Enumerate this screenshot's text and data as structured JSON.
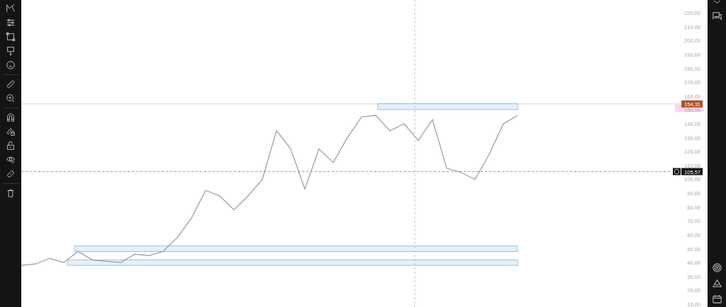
{
  "chart_data": {
    "type": "line",
    "ylim": [
      8,
      229.2
    ],
    "yticks": [
      {
        "value": 220,
        "label": "220,00"
      },
      {
        "value": 210,
        "label": "210,00"
      },
      {
        "value": 200,
        "label": "200,00"
      },
      {
        "value": 190,
        "label": "190,00"
      },
      {
        "value": 180,
        "label": "180,00"
      },
      {
        "value": 170,
        "label": "170,00"
      },
      {
        "value": 160,
        "label": "160,00"
      },
      {
        "value": 150,
        "label": "150,00"
      },
      {
        "value": 140,
        "label": "140,00"
      },
      {
        "value": 130,
        "label": "130,00"
      },
      {
        "value": 120,
        "label": "120,00"
      },
      {
        "value": 110,
        "label": "110,00"
      },
      {
        "value": 100,
        "label": "100,00"
      },
      {
        "value": 90,
        "label": "90,00"
      },
      {
        "value": 80,
        "label": "80,00"
      },
      {
        "value": 70,
        "label": "70,00"
      },
      {
        "value": 60,
        "label": "60,00"
      },
      {
        "value": 50,
        "label": "50,00"
      },
      {
        "value": 40,
        "label": "40,00"
      },
      {
        "value": 30,
        "label": "30,00"
      },
      {
        "value": 20,
        "label": "20,00"
      },
      {
        "value": 10,
        "label": "10,00"
      }
    ],
    "series": [
      {
        "color": "#9a9a9a",
        "values": [
          38,
          39,
          43,
          40,
          48,
          42,
          41,
          40,
          46,
          45,
          48,
          58,
          72,
          92,
          88,
          78,
          88,
          100,
          135,
          122,
          93,
          122,
          112,
          130,
          145,
          146,
          135,
          140,
          128,
          143,
          108,
          105,
          100,
          118,
          140,
          146
        ]
      }
    ],
    "ref_lines": [
      {
        "axis": "y",
        "value": 154.31,
        "label": "154,31",
        "color": "#d8d8d8"
      },
      {
        "axis": "y",
        "value": 105.57,
        "label": "105,57",
        "color": "#999999"
      }
    ]
  }
}
